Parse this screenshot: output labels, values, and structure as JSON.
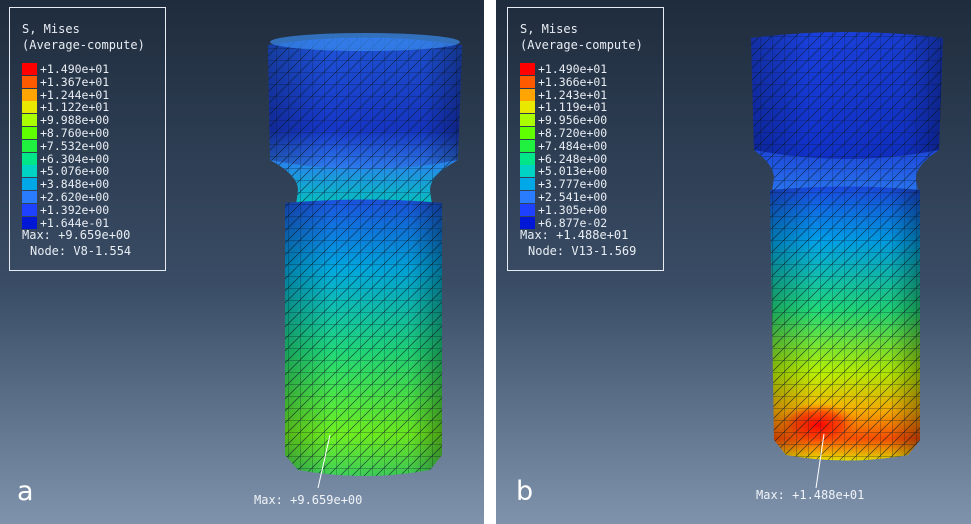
{
  "panels": [
    {
      "letter": "a",
      "legend": {
        "title": "S, Mises",
        "subtitle": "(Average-compute)",
        "values": [
          "+1.490e+01",
          "+1.367e+01",
          "+1.244e+01",
          "+1.122e+01",
          "+9.988e+00",
          "+8.760e+00",
          "+7.532e+00",
          "+6.304e+00",
          "+5.076e+00",
          "+3.848e+00",
          "+2.620e+00",
          "+1.392e+00",
          "+1.644e-01"
        ],
        "max_text": "Max: +9.659e+00",
        "node_text": "Node: V8-1.554"
      },
      "max_annotation": "Max: +9.659e+00"
    },
    {
      "letter": "b",
      "legend": {
        "title": "S, Mises",
        "subtitle": "(Average-compute)",
        "values": [
          "+1.490e+01",
          "+1.366e+01",
          "+1.243e+01",
          "+1.119e+01",
          "+9.956e+00",
          "+8.720e+00",
          "+7.484e+00",
          "+6.248e+00",
          "+5.013e+00",
          "+3.777e+00",
          "+2.541e+00",
          "+1.305e+00",
          "+6.877e-02"
        ],
        "max_text": "Max: +1.488e+01",
        "node_text": "Node: V13-1.569"
      },
      "max_annotation": "Max: +1.488e+01"
    }
  ],
  "colors": {
    "scale": [
      "#ff0000",
      "#ff5a00",
      "#ffa400",
      "#e8e800",
      "#aaff00",
      "#5fff00",
      "#20f040",
      "#00e688",
      "#00d2c4",
      "#00a8e8",
      "#2a7cff",
      "#1e40ff",
      "#0018d6"
    ],
    "background_top": "#1f2c3d",
    "background_bottom": "#7f93ad"
  }
}
